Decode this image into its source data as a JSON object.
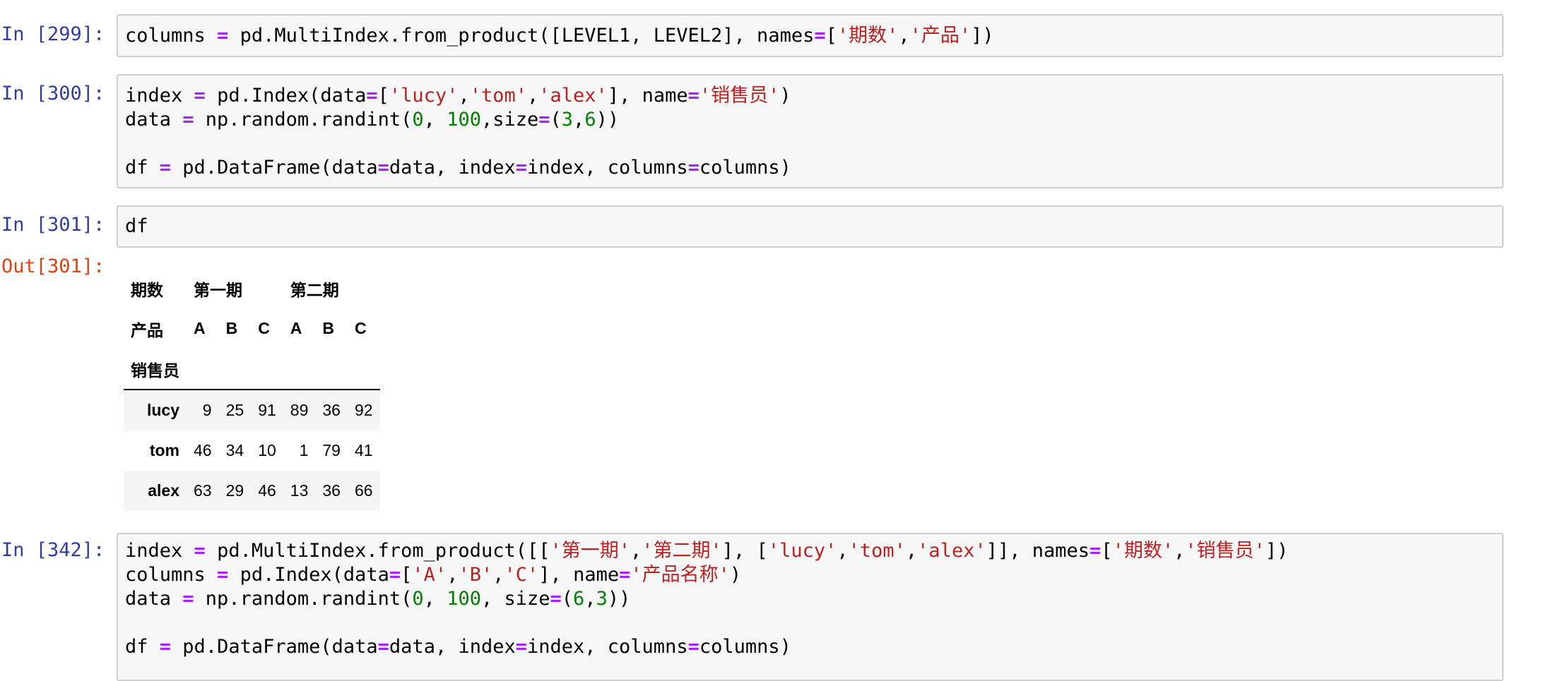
{
  "cells": [
    {
      "prompt": "In [299]:",
      "lines": [
        [
          {
            "t": "columns ",
            "c": ""
          },
          {
            "t": "=",
            "c": "op"
          },
          {
            "t": " pd.MultiIndex.from_product([LEVEL1, LEVEL2], names",
            "c": ""
          },
          {
            "t": "=",
            "c": "op"
          },
          {
            "t": "[",
            "c": ""
          },
          {
            "t": "'期数'",
            "c": "str"
          },
          {
            "t": ",",
            "c": ""
          },
          {
            "t": "'产品'",
            "c": "str"
          },
          {
            "t": "])",
            "c": ""
          }
        ]
      ]
    },
    {
      "prompt": "In [300]:",
      "lines": [
        [
          {
            "t": "index ",
            "c": ""
          },
          {
            "t": "=",
            "c": "op"
          },
          {
            "t": " pd.Index(data",
            "c": ""
          },
          {
            "t": "=",
            "c": "op"
          },
          {
            "t": "[",
            "c": ""
          },
          {
            "t": "'lucy'",
            "c": "str"
          },
          {
            "t": ",",
            "c": ""
          },
          {
            "t": "'tom'",
            "c": "str"
          },
          {
            "t": ",",
            "c": ""
          },
          {
            "t": "'alex'",
            "c": "str"
          },
          {
            "t": "], name",
            "c": ""
          },
          {
            "t": "=",
            "c": "op"
          },
          {
            "t": "'销售员'",
            "c": "str"
          },
          {
            "t": ")",
            "c": ""
          }
        ],
        [
          {
            "t": "data ",
            "c": ""
          },
          {
            "t": "=",
            "c": "op"
          },
          {
            "t": " np.random.randint(",
            "c": ""
          },
          {
            "t": "0",
            "c": "num"
          },
          {
            "t": ", ",
            "c": ""
          },
          {
            "t": "100",
            "c": "num"
          },
          {
            "t": ",size",
            "c": ""
          },
          {
            "t": "=",
            "c": "op"
          },
          {
            "t": "(",
            "c": ""
          },
          {
            "t": "3",
            "c": "num"
          },
          {
            "t": ",",
            "c": ""
          },
          {
            "t": "6",
            "c": "num"
          },
          {
            "t": "))",
            "c": ""
          }
        ],
        [],
        [
          {
            "t": "df ",
            "c": ""
          },
          {
            "t": "=",
            "c": "op"
          },
          {
            "t": " pd.DataFrame(data",
            "c": ""
          },
          {
            "t": "=",
            "c": "op"
          },
          {
            "t": "data, index",
            "c": ""
          },
          {
            "t": "=",
            "c": "op"
          },
          {
            "t": "index, columns",
            "c": ""
          },
          {
            "t": "=",
            "c": "op"
          },
          {
            "t": "columns)",
            "c": ""
          }
        ]
      ]
    },
    {
      "prompt": "In [301]:",
      "lines": [
        [
          {
            "t": "df",
            "c": ""
          }
        ]
      ]
    },
    {
      "prompt": "In [342]:",
      "lines": [
        [
          {
            "t": "index ",
            "c": ""
          },
          {
            "t": "=",
            "c": "op"
          },
          {
            "t": " pd.MultiIndex.from_product([[",
            "c": ""
          },
          {
            "t": "'第一期'",
            "c": "str"
          },
          {
            "t": ",",
            "c": ""
          },
          {
            "t": "'第二期'",
            "c": "str"
          },
          {
            "t": "], [",
            "c": ""
          },
          {
            "t": "'lucy'",
            "c": "str"
          },
          {
            "t": ",",
            "c": ""
          },
          {
            "t": "'tom'",
            "c": "str"
          },
          {
            "t": ",",
            "c": ""
          },
          {
            "t": "'alex'",
            "c": "str"
          },
          {
            "t": "]], names",
            "c": ""
          },
          {
            "t": "=",
            "c": "op"
          },
          {
            "t": "[",
            "c": ""
          },
          {
            "t": "'期数'",
            "c": "str"
          },
          {
            "t": ",",
            "c": ""
          },
          {
            "t": "'销售员'",
            "c": "str"
          },
          {
            "t": "])",
            "c": ""
          }
        ],
        [
          {
            "t": "columns ",
            "c": ""
          },
          {
            "t": "=",
            "c": "op"
          },
          {
            "t": " pd.Index(data",
            "c": ""
          },
          {
            "t": "=",
            "c": "op"
          },
          {
            "t": "[",
            "c": ""
          },
          {
            "t": "'A'",
            "c": "str"
          },
          {
            "t": ",",
            "c": ""
          },
          {
            "t": "'B'",
            "c": "str"
          },
          {
            "t": ",",
            "c": ""
          },
          {
            "t": "'C'",
            "c": "str"
          },
          {
            "t": "], name",
            "c": ""
          },
          {
            "t": "=",
            "c": "op"
          },
          {
            "t": "'产品名称'",
            "c": "str"
          },
          {
            "t": ")",
            "c": ""
          }
        ],
        [
          {
            "t": "data ",
            "c": ""
          },
          {
            "t": "=",
            "c": "op"
          },
          {
            "t": " np.random.randint(",
            "c": ""
          },
          {
            "t": "0",
            "c": "num"
          },
          {
            "t": ", ",
            "c": ""
          },
          {
            "t": "100",
            "c": "num"
          },
          {
            "t": ", size",
            "c": ""
          },
          {
            "t": "=",
            "c": "op"
          },
          {
            "t": "(",
            "c": ""
          },
          {
            "t": "6",
            "c": "num"
          },
          {
            "t": ",",
            "c": ""
          },
          {
            "t": "3",
            "c": "num"
          },
          {
            "t": "))",
            "c": ""
          }
        ],
        [],
        [
          {
            "t": "df ",
            "c": ""
          },
          {
            "t": "=",
            "c": "op"
          },
          {
            "t": " pd.DataFrame(data",
            "c": ""
          },
          {
            "t": "=",
            "c": "op"
          },
          {
            "t": "data, index",
            "c": ""
          },
          {
            "t": "=",
            "c": "op"
          },
          {
            "t": "index, columns",
            "c": ""
          },
          {
            "t": "=",
            "c": "op"
          },
          {
            "t": "columns)",
            "c": ""
          }
        ]
      ]
    }
  ],
  "output": {
    "prompt": "Out[301]:",
    "table": {
      "level0_name": "期数",
      "level0_groups": [
        "第一期",
        "第二期"
      ],
      "level1_name": "产品",
      "level1_labels": [
        "A",
        "B",
        "C",
        "A",
        "B",
        "C"
      ],
      "index_name": "销售员",
      "rows": [
        {
          "label": "lucy",
          "values": [
            9,
            25,
            91,
            89,
            36,
            92
          ]
        },
        {
          "label": "tom",
          "values": [
            46,
            34,
            10,
            1,
            79,
            41
          ]
        },
        {
          "label": "alex",
          "values": [
            63,
            29,
            46,
            13,
            36,
            66
          ]
        }
      ]
    }
  },
  "colors": {
    "in_prompt": "#303f9f",
    "out_prompt": "#d84315",
    "operator": "#aa22ff",
    "string": "#ba2121",
    "number": "#008000",
    "cell_bg": "#f7f7f7",
    "cell_border": "#cfcfcf"
  }
}
